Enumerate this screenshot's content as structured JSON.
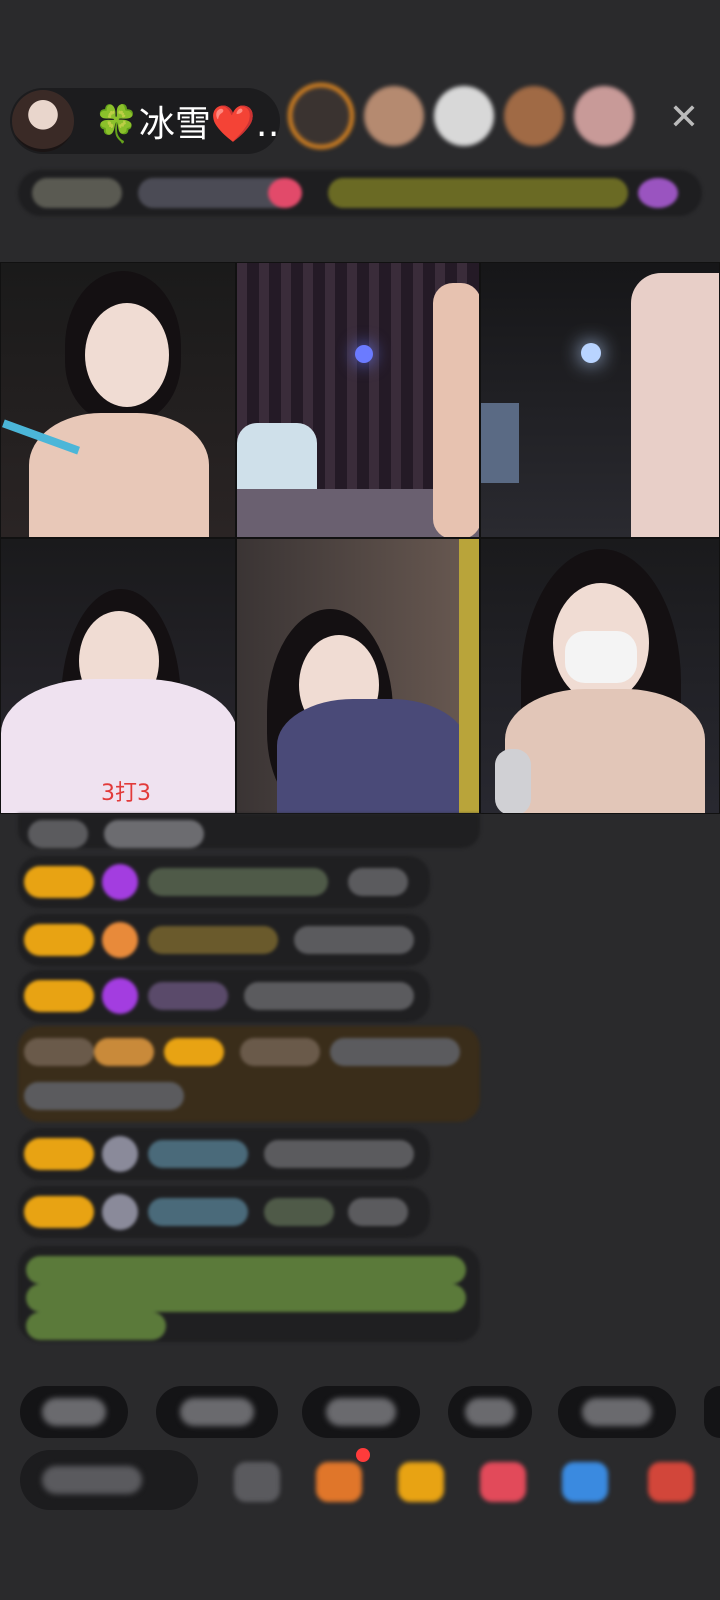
{
  "host": {
    "name": "🍀冰雪❤️…"
  },
  "viewers": {
    "count_visible": 5,
    "items": [
      "viewer-1",
      "viewer-2",
      "viewer-3",
      "viewer-4",
      "viewer-5"
    ]
  },
  "close": {
    "icon": "close-icon",
    "symbol": "✕"
  },
  "grid": {
    "cells": [
      {
        "name": "stream-tile-1",
        "label": ""
      },
      {
        "name": "stream-tile-2",
        "label": ""
      },
      {
        "name": "stream-tile-3",
        "label": ""
      },
      {
        "name": "stream-tile-4",
        "label": "3打3"
      },
      {
        "name": "stream-tile-5",
        "label": ""
      },
      {
        "name": "stream-tile-6",
        "label": ""
      }
    ]
  },
  "colors": {
    "background": "#2a2a2c",
    "badge": "#e8a313",
    "accent_orange": "#e58a20",
    "system_message_green": "#8bc34a",
    "gem_purple": "#a33de0"
  }
}
